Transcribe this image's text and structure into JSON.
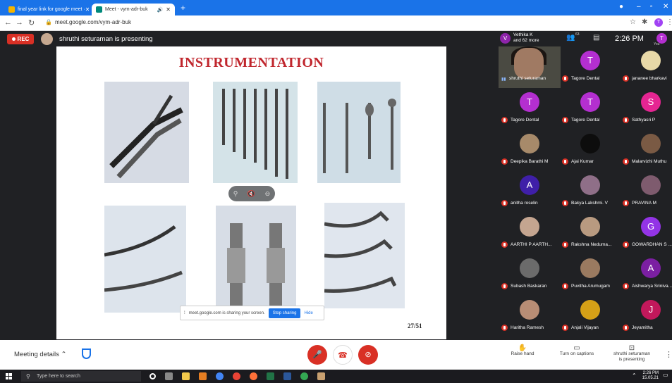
{
  "browser": {
    "tabs": [
      {
        "label": "final year link for google meet ·",
        "active": false,
        "favicon_color": "#f4b400"
      },
      {
        "label": "Meet - vym-adr-buk",
        "active": true,
        "favicon_color": "#00897b"
      }
    ],
    "url": "meet.google.com/vym-adr-buk",
    "profile_initial": "T"
  },
  "meet": {
    "rec_label": "REC",
    "presenting_text": "shruthi seturaman is presenting",
    "header": {
      "viewer_initial": "V",
      "viewer_line1": "Vethika K",
      "viewer_line2": "and 62 more",
      "participant_count": "63",
      "time": "2:26 PM",
      "you_initial": "T",
      "you_label": "You"
    },
    "slide": {
      "title": "INSTRUMENTATION",
      "page": "27/51"
    },
    "share_bar": {
      "text": "meet.google.com is sharing your screen.",
      "stop_label": "Stop sharing",
      "hide_label": "Hide"
    },
    "participants": [
      {
        "name": "shruthi seturaman",
        "initial": "",
        "color": "#4a4a42",
        "camera": true
      },
      {
        "name": "Tagore Dental",
        "initial": "T",
        "color": "#b42fd0"
      },
      {
        "name": "jananee bharkavi",
        "initial": "",
        "color": "#e8d9a8"
      },
      {
        "name": "Tagore Dental",
        "initial": "T",
        "color": "#b42fd0"
      },
      {
        "name": "Tagore Dental",
        "initial": "T",
        "color": "#b42fd0"
      },
      {
        "name": "Sathyasri P",
        "initial": "S",
        "color": "#e52592"
      },
      {
        "name": "Deepika Barathi M",
        "initial": "",
        "color": "#a78a6a"
      },
      {
        "name": "Ajai Kumar",
        "initial": "",
        "color": "#0d0d0d"
      },
      {
        "name": "Malarvizhi Muthu",
        "initial": "",
        "color": "#7a5a44"
      },
      {
        "name": "anitha roselin",
        "initial": "A",
        "color": "#3f1fa8"
      },
      {
        "name": "Bakya Lakshmi. V",
        "initial": "",
        "color": "#8f6f88"
      },
      {
        "name": "PRAVINA M",
        "initial": "",
        "color": "#7e5b6e"
      },
      {
        "name": "AARTHI P AARTH...",
        "initial": "",
        "color": "#c4a590"
      },
      {
        "name": "Rakshna Neduma...",
        "initial": "",
        "color": "#b89a80"
      },
      {
        "name": "GOWARDHAN S ...",
        "initial": "G",
        "color": "#9334e6"
      },
      {
        "name": "Subash Baskaran",
        "initial": "",
        "color": "#6b6b6b"
      },
      {
        "name": "Puvitha Arumugam",
        "initial": "",
        "color": "#9a7a60"
      },
      {
        "name": "Aishwarya Sriniva...",
        "initial": "A",
        "color": "#7b1fa2"
      },
      {
        "name": "Haritha Ramesh",
        "initial": "",
        "color": "#b88d75"
      },
      {
        "name": "Anjali Vijayan",
        "initial": "",
        "color": "#d4a017"
      },
      {
        "name": "Jeyamitha",
        "initial": "J",
        "color": "#c2185b"
      }
    ],
    "bottom": {
      "meeting_details": "Meeting details",
      "raise_hand": "Raise hand",
      "captions": "Turn on captions",
      "presenting_line1": "shruthi seturaman",
      "presenting_line2": "is presenting"
    }
  },
  "taskbar": {
    "search_placeholder": "Type here to search",
    "time": "2:26 PM",
    "date": "15.05.21"
  }
}
